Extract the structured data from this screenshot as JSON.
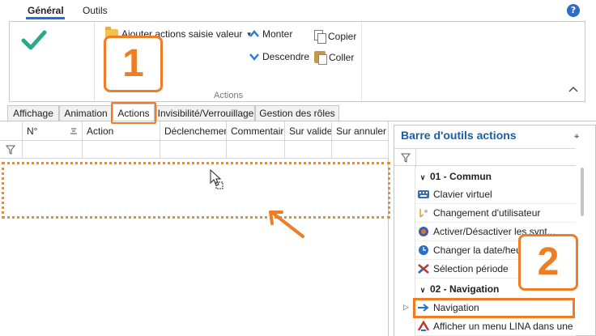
{
  "ribbon": {
    "tabs": [
      {
        "label": "Général",
        "active": true
      },
      {
        "label": "Outils",
        "active": false
      }
    ],
    "help_icon": "question-circle-icon",
    "help_glyph": "?",
    "buttons": {
      "add_actions": "Ajouter actions saisie valeur",
      "move_up": "Monter",
      "move_down": "Descendre",
      "copy": "Copier",
      "paste": "Coller"
    },
    "group_label": "Actions",
    "accent_color": "#1f6fd6"
  },
  "page_tabs": [
    {
      "label": "Affichage",
      "active": false
    },
    {
      "label": "Animation",
      "active": false
    },
    {
      "label": "Actions",
      "active": true
    },
    {
      "label": "Invisibilité/Verrouillage",
      "active": false
    },
    {
      "label": "Gestion des rôles",
      "active": false
    }
  ],
  "grid": {
    "columns": [
      "N°",
      "Action",
      "Déclenchement",
      "Commentaire",
      "Sur valider",
      "Sur annuler"
    ],
    "rows": []
  },
  "toolbar_panel": {
    "title": "Barre d'outils actions",
    "groups": [
      {
        "label": "01 - Commun",
        "items": [
          {
            "label": "Clavier virtuel",
            "icon": "keyboard-icon"
          },
          {
            "label": "Changement d'utilisateur",
            "icon": "user-switch-icon"
          },
          {
            "label": "Activer/Désactiver les synt...",
            "icon": "toggle-sync-icon"
          },
          {
            "label": "Changer la date/heure...",
            "icon": "clock-icon"
          },
          {
            "label": "Sélection période",
            "icon": "period-icon"
          }
        ]
      },
      {
        "label": "02 - Navigation",
        "items": [
          {
            "label": "Navigation",
            "icon": "navigation-arrow-icon"
          },
          {
            "label": "Afficher un menu LINA dans une ...",
            "icon": "menu-icon"
          }
        ]
      }
    ]
  },
  "annotations": {
    "callout_1": "1",
    "callout_2": "2",
    "color": "#ee7d24"
  }
}
